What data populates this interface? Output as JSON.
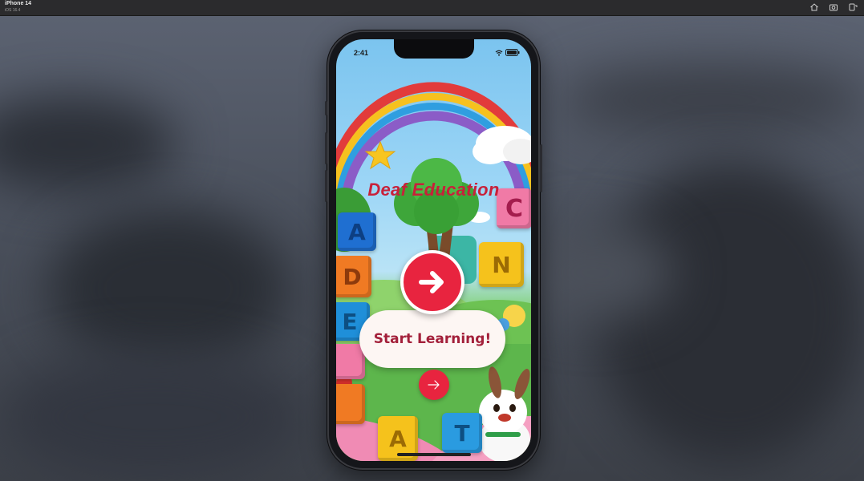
{
  "simulator": {
    "device_name": "iPhone 14",
    "os_version": "iOS 16.4",
    "icons": [
      "home-icon",
      "screenshot-icon",
      "rotate-icon"
    ]
  },
  "status_bar": {
    "time": "2:41",
    "icons": [
      "wifi-icon",
      "battery-icon"
    ]
  },
  "app": {
    "title": "Deaf Education",
    "start_button_label": "Start Learning!",
    "accent_color": "#e8243f",
    "title_color": "#c8213a"
  },
  "scene": {
    "blocks": [
      {
        "letter": "A",
        "color": "#1f6fd1"
      },
      {
        "letter": "D",
        "color": "#f07a23"
      },
      {
        "letter": "E",
        "color": "#1f8fd9"
      },
      {
        "letter": "C",
        "color": "#f07aa6"
      },
      {
        "letter": "N",
        "color": "#f5c21c"
      },
      {
        "letter": "A",
        "color": "#f5c21c"
      },
      {
        "letter": "T",
        "color": "#2a9be0"
      }
    ]
  }
}
